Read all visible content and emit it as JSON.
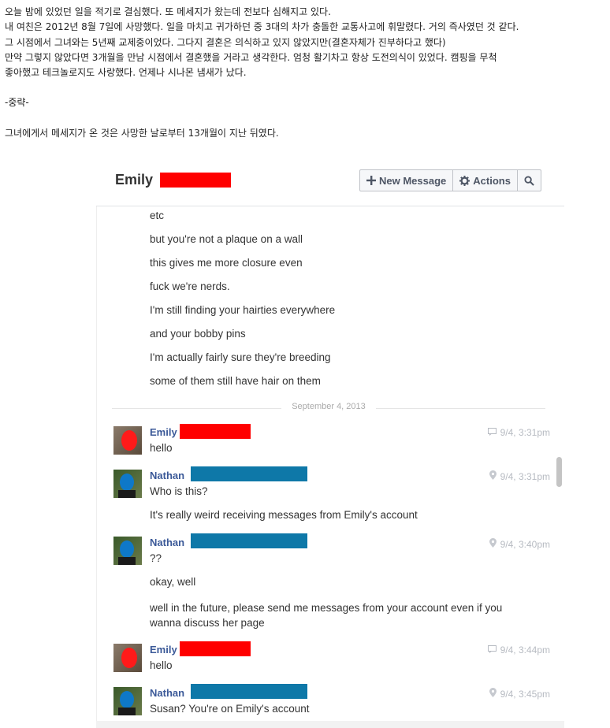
{
  "intro": {
    "lines": [
      "오늘 밤에 있었던 일을 적기로 결심했다. 또 메세지가 왔는데 전보다 심해지고 있다.",
      "내 여친은 2012년 8월 7일에 사망했다. 일을 마치고 귀가하던 중 3대의 차가 충돌한 교통사고에 휘말렸다. 거의 즉사였던 것 같다.",
      "그 시점에서 그녀와는 5년째 교제중이었다. 그다지 결혼은 의식하고 있지 않았지만(결혼자체가 진부하다고 했다)",
      "만약 그렇지 않았다면 3개월을 만남 시점에서 결혼했을 거라고 생각한다. 엄청 활기차고 항상 도전의식이 있었다. 캠핑을 무척",
      "좋아했고 테크놀로지도 사랑했다. 언제나 시나몬 냄새가 났다."
    ],
    "omitted": "-중략-",
    "closing": "그녀에게서 메세지가 온 것은 사망한 날로부터 13개월이 지난 뒤였다."
  },
  "header": {
    "title": "Emily",
    "new_message": "New Message",
    "actions": "Actions"
  },
  "earlier_messages": [
    "etc",
    "but you're not a plaque on a wall",
    "this gives me more closure even",
    "fuck we're nerds.",
    "I'm still finding your hairties everywhere",
    "and your bobby pins",
    "I'm actually fairly sure they're breeding",
    "some of them still have hair on them"
  ],
  "divider_date": "September 4, 2013",
  "groups": [
    {
      "sender": "Emily",
      "time": "9/4, 3:31pm",
      "icon": "chat-bubble-icon",
      "messages": [
        "hello"
      ]
    },
    {
      "sender": "Nathan",
      "time": "9/4, 3:31pm",
      "icon": "location-pin-icon",
      "messages": [
        "Who is this?",
        "It's really weird receiving messages from Emily's account"
      ]
    },
    {
      "sender": "Nathan",
      "time": "9/4, 3:40pm",
      "icon": "location-pin-icon",
      "messages": [
        "??",
        "okay, well",
        "well in the future, please send me messages from your account even if you wanna discuss her page"
      ]
    },
    {
      "sender": "Emily",
      "time": "9/4, 3:44pm",
      "icon": "chat-bubble-icon",
      "messages": [
        "hello"
      ]
    },
    {
      "sender": "Nathan",
      "time": "9/4, 3:45pm",
      "icon": "location-pin-icon",
      "messages": [
        "Susan? You're on Emily's account"
      ]
    }
  ],
  "colors": {
    "sender": "#3b5998",
    "redact_emily": "#ff0000",
    "redact_nathan": "#0e78a8"
  }
}
